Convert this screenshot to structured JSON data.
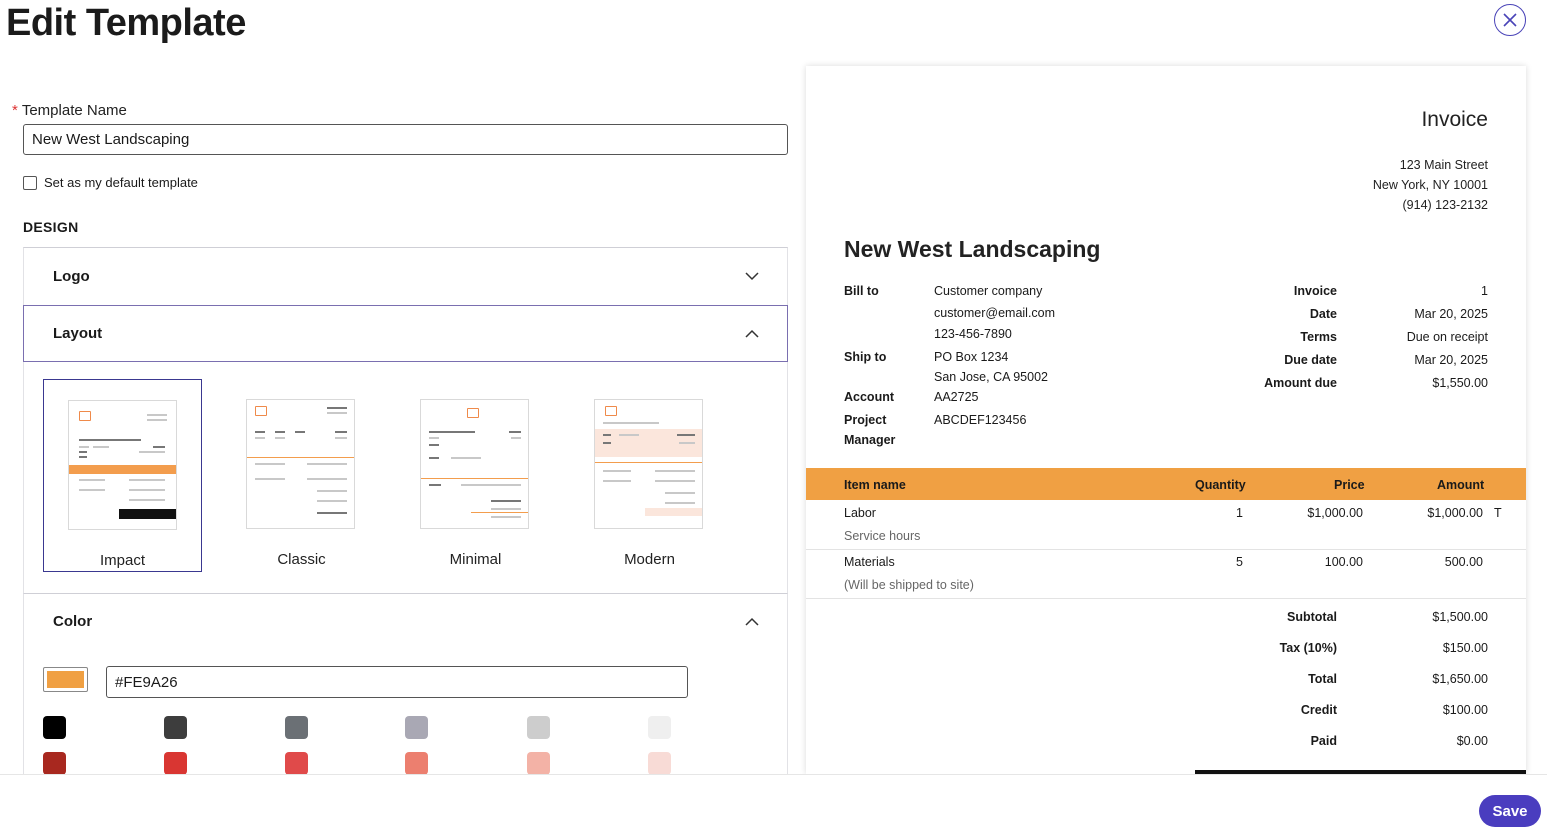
{
  "header": {
    "title": "Edit Template",
    "close_icon": "close-icon"
  },
  "form": {
    "template_name_label": "Template Name",
    "required_mark": "*",
    "template_name_value": "New West Landscaping",
    "default_checkbox_label": "Set as my default template",
    "default_checked": false,
    "design_heading": "DESIGN"
  },
  "sections": {
    "logo": {
      "label": "Logo",
      "expanded": false
    },
    "layout": {
      "label": "Layout",
      "expanded": true
    },
    "color": {
      "label": "Color",
      "expanded": true
    }
  },
  "layouts": [
    {
      "label": "Impact",
      "selected": true
    },
    {
      "label": "Classic",
      "selected": false
    },
    {
      "label": "Minimal",
      "selected": false
    },
    {
      "label": "Modern",
      "selected": false
    }
  ],
  "color": {
    "hex_value": "#FE9A26",
    "swatch_color": "#f0a043",
    "swatches_row1": [
      "#000000",
      "#3d3d3d",
      "#6b7075",
      "#a9a8b4",
      "#cdcdcd",
      "#efefef"
    ],
    "swatches_row2": [
      "#a8281f",
      "#d93632",
      "#e04a4a",
      "#ec7f6f",
      "#f3b2a6",
      "#f8dbd6"
    ]
  },
  "actions": {
    "save_label": "Save"
  },
  "invoice": {
    "title": "Invoice",
    "address_line1": "123 Main Street",
    "address_line2": "New York, NY 10001",
    "phone": "(914) 123-2132",
    "company": "New West Landscaping",
    "bill_to_label": "Bill to",
    "bill_to_name": "Customer company",
    "bill_to_email": "customer@email.com",
    "bill_to_phone": "123-456-7890",
    "ship_to_label": "Ship to",
    "ship_to_line1": "PO Box 1234",
    "ship_to_line2": "San Jose, CA 95002",
    "account_label": "Account",
    "account_value": "AA2725",
    "project_label_1": "Project",
    "project_label_2": "Manager",
    "project_value": "ABCDEF123456",
    "meta": [
      {
        "label": "Invoice",
        "value": "1"
      },
      {
        "label": "Date",
        "value": "Mar 20, 2025"
      },
      {
        "label": "Terms",
        "value": "Due on receipt"
      },
      {
        "label": "Due date",
        "value": "Mar 20, 2025"
      },
      {
        "label": "Amount due",
        "value": "$1,550.00"
      }
    ],
    "columns": {
      "item": "Item name",
      "qty": "Quantity",
      "price": "Price",
      "amount": "Amount"
    },
    "items": [
      {
        "name": "Labor",
        "desc": "Service hours",
        "qty": "1",
        "price": "$1,000.00",
        "amount": "$1,000.00",
        "flag": "T"
      },
      {
        "name": "Materials",
        "desc": "(Will be shipped to site)",
        "qty": "5",
        "price": "100.00",
        "amount": "500.00",
        "flag": ""
      }
    ],
    "totals": [
      {
        "label": "Subtotal",
        "value": "$1,500.00"
      },
      {
        "label": "Tax (10%)",
        "value": "$150.00"
      },
      {
        "label": "Total",
        "value": "$1,650.00"
      },
      {
        "label": "Credit",
        "value": "$100.00"
      },
      {
        "label": "Paid",
        "value": "$0.00"
      }
    ]
  }
}
